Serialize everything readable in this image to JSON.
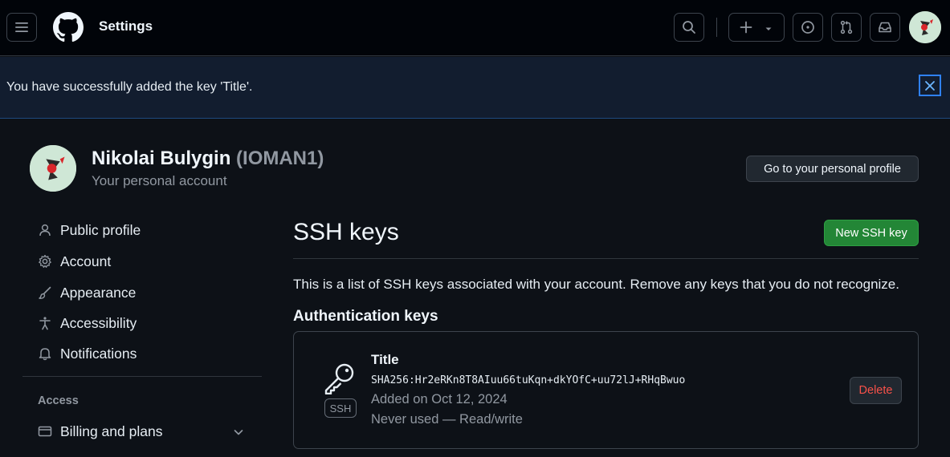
{
  "header": {
    "title": "Settings",
    "icons": [
      "menu-icon",
      "github-logo-icon",
      "search-icon",
      "plus-icon",
      "triangle-down-icon",
      "issue-icon",
      "pull-request-icon",
      "inbox-icon"
    ]
  },
  "flash": {
    "message": "You have successfully added the key 'Title'.",
    "close_icon": "x-icon"
  },
  "account": {
    "name": "Nikolai Bulygin",
    "login": "(IOMAN1)",
    "subtitle": "Your personal account",
    "profile_button": "Go to your personal profile"
  },
  "sidebar": {
    "items": [
      {
        "label": "Public profile",
        "icon": "person-icon"
      },
      {
        "label": "Account",
        "icon": "gear-icon"
      },
      {
        "label": "Appearance",
        "icon": "paintbrush-icon"
      },
      {
        "label": "Accessibility",
        "icon": "accessibility-icon"
      },
      {
        "label": "Notifications",
        "icon": "bell-icon"
      }
    ],
    "access_heading": "Access",
    "access_items": [
      {
        "label": "Billing and plans",
        "icon": "credit-card-icon"
      }
    ]
  },
  "main": {
    "title": "SSH keys",
    "new_key_button": "New SSH key",
    "description": "This is a list of SSH keys associated with your account. Remove any keys that you do not recognize.",
    "section_heading": "Authentication keys",
    "keys": [
      {
        "title": "Title",
        "fingerprint": "SHA256:Hr2eRKn8T8AIuu66tuKqn+dkYOfC+uu72lJ+RHqBwuo",
        "added": "Added on Oct 12, 2024",
        "usage": "Never used — Read/write",
        "badge": "SSH",
        "delete_label": "Delete"
      }
    ]
  },
  "colors": {
    "background": "#0d1117",
    "header_bg": "#010409",
    "flash_bg": "#121d2f",
    "primary_button": "#238636",
    "danger_text": "#f85149",
    "muted_text": "#9198a1"
  }
}
